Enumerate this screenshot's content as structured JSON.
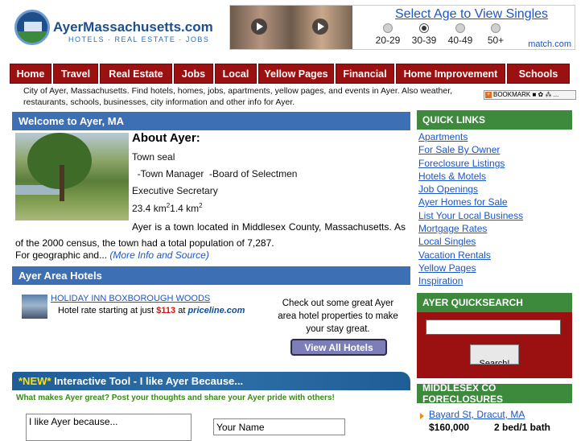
{
  "header": {
    "site_name": "AyerMassachusetts.com",
    "tagline": "HOTELS  ·  REAL ESTATE  ·  JOBS"
  },
  "ad": {
    "headline": "Select Age to View Singles",
    "ages": [
      "20-29",
      "30-39",
      "40-49",
      "50+"
    ],
    "selected_age": "30-39",
    "brand": "match.com"
  },
  "nav": {
    "items": [
      "Home",
      "Travel",
      "Real Estate",
      "Jobs",
      "Local",
      "Yellow Pages",
      "Financial",
      "Home Improvement",
      "Schools"
    ]
  },
  "intro": "City of Ayer, Massachusetts. Find hotels, homes, jobs, apartments, yellow pages, and events in Ayer. Also weather, restaurants, schools, businesses, city information and other info for Ayer.",
  "bookmark": {
    "label": "BOOKMARK",
    "icons": "■ ✿ ⁂ ..."
  },
  "welcome": {
    "title": "Welcome to Ayer, MA",
    "about_heading": "About Ayer:",
    "lines": [
      "Town seal",
      "  -Town Manager  -Board of Selectmen",
      "Executive Secretary"
    ],
    "area_km": "23.4 km",
    "area_sep": "1.4 km",
    "area_sup": "2",
    "paragraph": "Ayer is a town located in Middlesex County, Massachusetts. As of the 2000 census, the town had a total population of 7,287.",
    "more_prefix": "For geographic and...",
    "more_link": "(More Info and Source)"
  },
  "hotels": {
    "title": "Ayer Area Hotels",
    "hotel_name": "HOLIDAY INN BOXBOROUGH WOODS",
    "rate_prefix": "Hotel rate starting at just ",
    "rate_price": "$113",
    "rate_suffix": " at ",
    "rate_brand": "priceline.com",
    "cta": "Check out some great Ayer area hotel properties to make your stay great.",
    "view_all": "View All Hotels"
  },
  "tool": {
    "new_tag": "*NEW*",
    "title": " Interactive Tool - I like Ayer Because...",
    "subtitle": "What makes Ayer great? Post your thoughts and share your Ayer pride with others!",
    "like_value": "I like Ayer because...",
    "name_value": "Your Name"
  },
  "quick_links": {
    "title": "QUICK LINKS",
    "items": [
      "Apartments",
      "For Sale By Owner",
      "Foreclosure Listings",
      "Hotels & Motels",
      "Job Openings",
      "Ayer Homes for Sale",
      "List Your Local Business",
      "Mortgage Rates",
      "Local Singles",
      "Vacation Rentals",
      "Yellow Pages",
      "Inspiration"
    ]
  },
  "quicksearch": {
    "title": "AYER QUICKSEARCH",
    "button": "Search!"
  },
  "foreclosures": {
    "title": "MIDDLESEX CO FORECLOSURES",
    "address": "Bayard St, Dracut, MA",
    "price": "$160,000",
    "beds": "2 bed/1 bath"
  }
}
